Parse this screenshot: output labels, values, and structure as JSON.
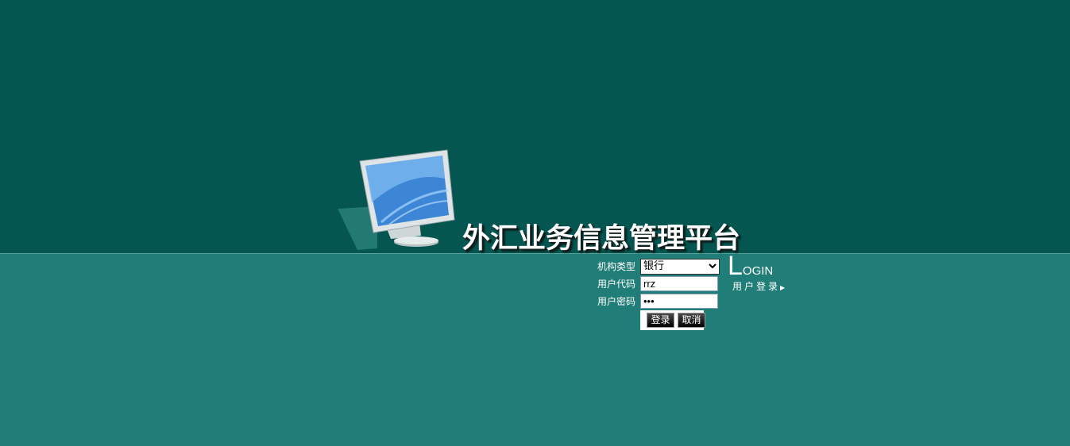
{
  "header": {
    "title": "外汇业务信息管理平台"
  },
  "login_form": {
    "org_type_label": "机构类型",
    "org_type_value": "银行",
    "user_code_label": "用户代码",
    "user_code_value": "rrz",
    "password_label": "用户密码",
    "password_value": "•••",
    "login_button": "登录",
    "cancel_button": "取消"
  },
  "login_badge": {
    "big_letter": "L",
    "rest": "OGIN",
    "subtitle": "用户登录",
    "arrow": "▶"
  },
  "colors": {
    "top_background": "#055650",
    "bottom_background": "#207d77"
  },
  "icons": {
    "monitor": "monitor-illustration",
    "dropdown": "chevron-down-icon"
  }
}
